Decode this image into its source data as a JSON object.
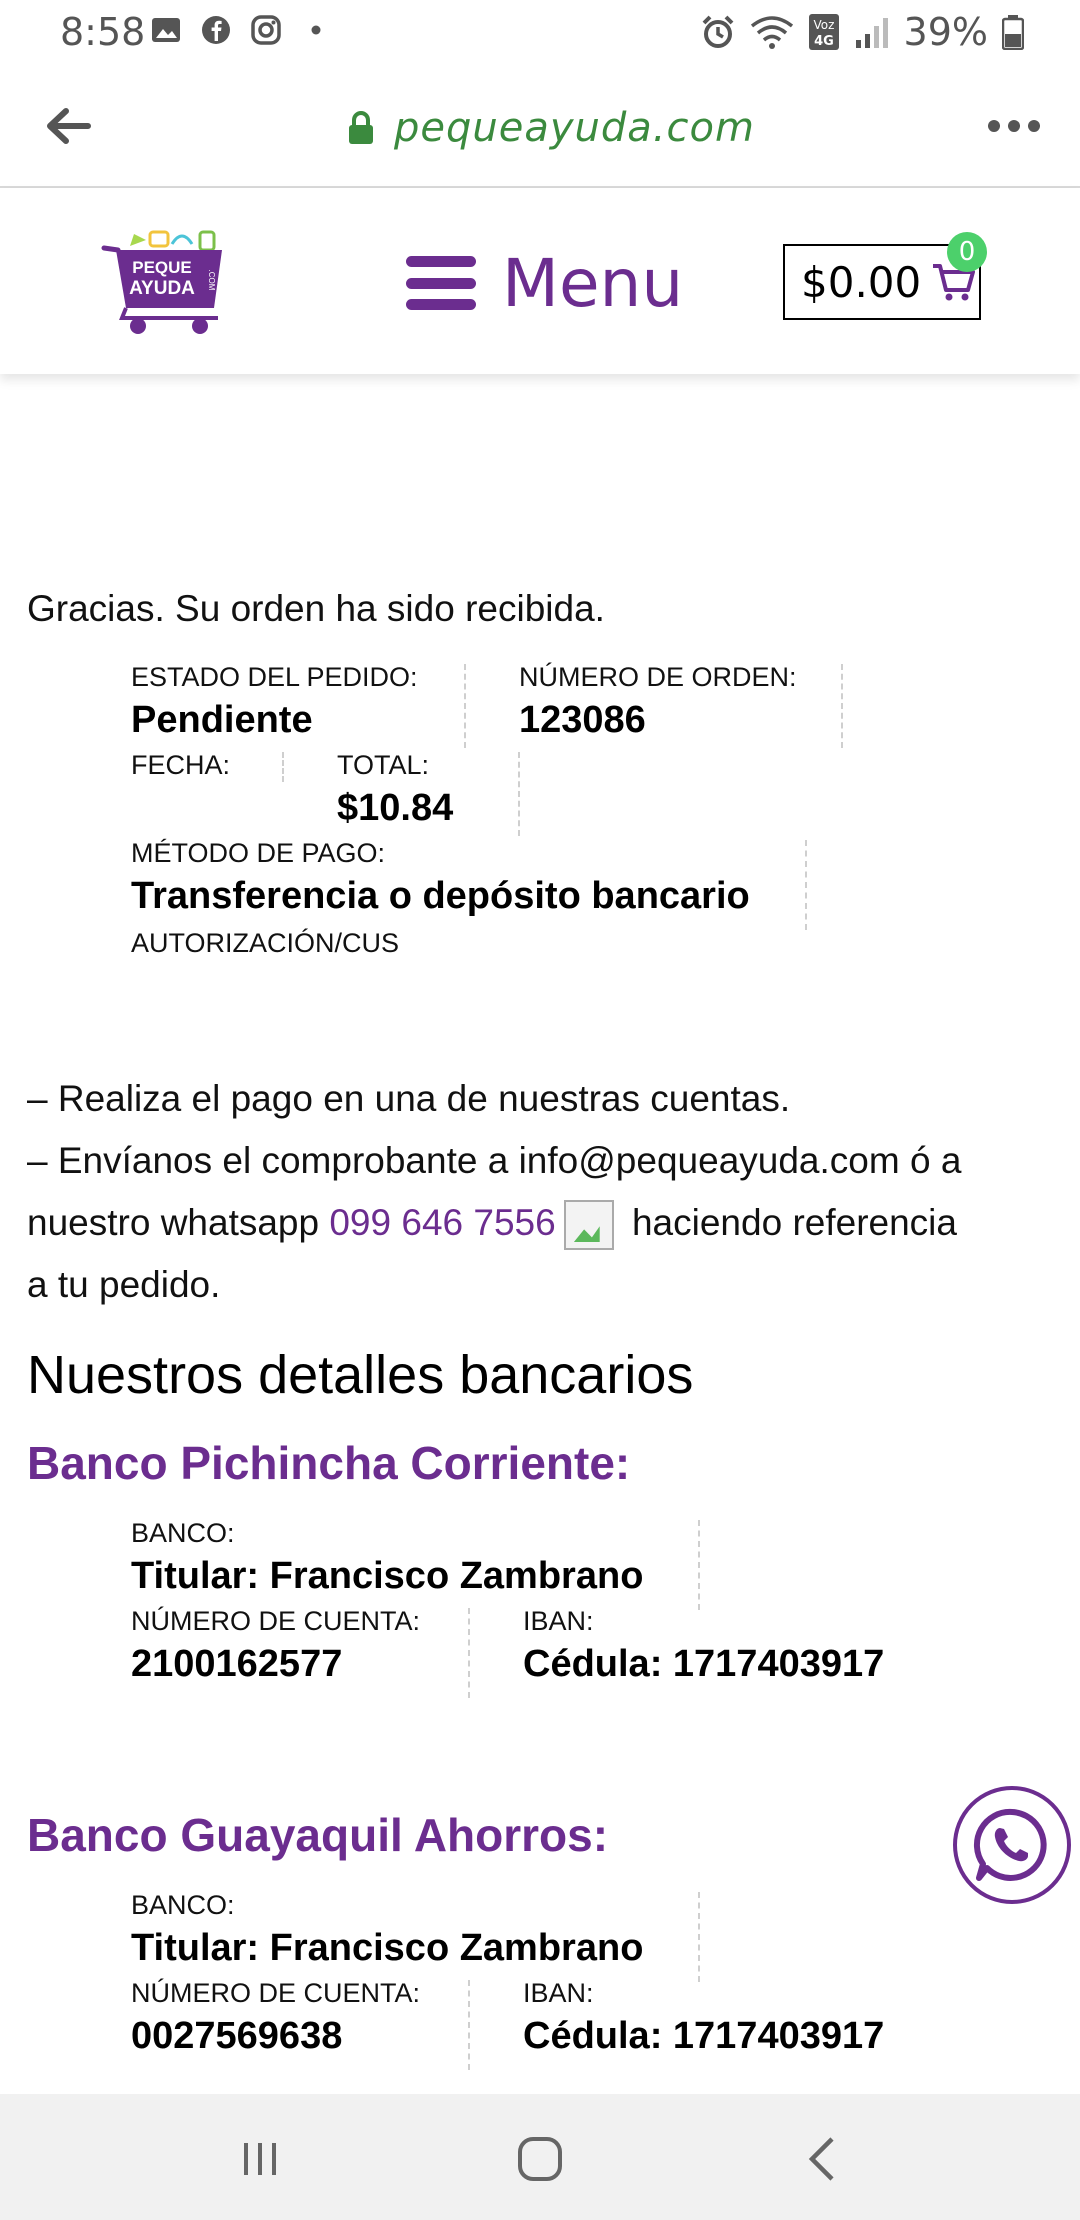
{
  "status_bar": {
    "time": "8:58",
    "battery": "39%",
    "left_icons": [
      "gallery-icon",
      "facebook-icon",
      "instagram-icon",
      "dot-icon"
    ],
    "right_icons": [
      "alarm-icon",
      "wifi-icon",
      "volte-4g-icon",
      "signal-icon",
      "battery-icon"
    ]
  },
  "browser": {
    "url": "pequeayuda.com"
  },
  "header": {
    "menu_label": "Menu",
    "cart_amount": "$0.00",
    "cart_count": "0",
    "logo_text_1": "PEQUE",
    "logo_text_2": "AYUDA",
    "logo_text_3": ".COM"
  },
  "order": {
    "thanks": "Gracias. Su orden ha sido recibida.",
    "status_label": "ESTADO DEL PEDIDO:",
    "status_value": "Pendiente",
    "number_label": "NÚMERO DE ORDEN:",
    "number_value": "123086",
    "date_label": "FECHA:",
    "total_label": "TOTAL:",
    "total_value": "$10.84",
    "method_label": "MÉTODO DE PAGO:",
    "method_value": "Transferencia o depósito bancario",
    "auth_label": "AUTORIZACIÓN/CUS"
  },
  "instructions": {
    "line1": "– Realiza el pago en una de nuestras cuentas.",
    "line2_a": "– Envíanos el comprobante a info@pequeayuda.com ó a",
    "line3_a": "nuestro whatsapp ",
    "whatsapp_number": "099 646 7556",
    "line3_b": " haciendo referencia",
    "line4": "a tu pedido."
  },
  "bank_section": {
    "title": "Nuestros detalles bancarios",
    "banks": [
      {
        "name": "Banco Pichincha Corriente:",
        "bank_label": "BANCO:",
        "holder": "Titular: Francisco Zambrano",
        "account_label": "NÚMERO DE CUENTA:",
        "account": "2100162577",
        "iban_label": "IBAN:",
        "iban": "Cédula: 1717403917"
      },
      {
        "name": "Banco Guayaquil Ahorros:",
        "bank_label": "BANCO:",
        "holder": "Titular: Francisco Zambrano",
        "account_label": "NÚMERO DE CUENTA:",
        "account": "0027569638",
        "iban_label": "IBAN:",
        "iban": "Cédula: 1717403917"
      }
    ]
  },
  "colors": {
    "brand_purple": "#6b2d8f",
    "url_green": "#3b8a3e",
    "badge_green": "#4cd06b"
  }
}
